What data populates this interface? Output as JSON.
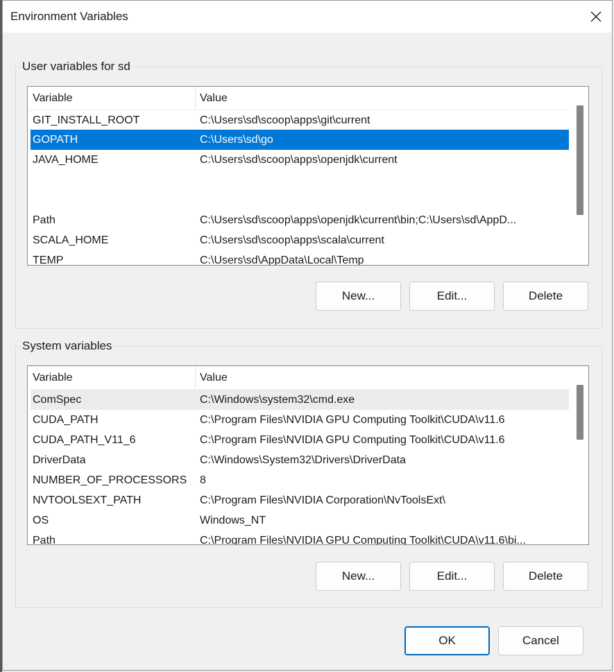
{
  "window": {
    "title": "Environment Variables",
    "close_label": "✕"
  },
  "user_section": {
    "label": "User variables for sd",
    "columns": [
      "Variable",
      "Value"
    ],
    "rows": [
      {
        "variable": "GIT_INSTALL_ROOT",
        "value": "C:\\Users\\sd\\scoop\\apps\\git\\current",
        "state": "normal"
      },
      {
        "variable": "GOPATH",
        "value": "C:\\Users\\sd\\go",
        "state": "selected"
      },
      {
        "variable": "JAVA_HOME",
        "value": "C:\\Users\\sd\\scoop\\apps\\openjdk\\current",
        "state": "normal"
      },
      {
        "variable": "Path",
        "value": "C:\\Users\\sd\\scoop\\apps\\openjdk\\current\\bin;C:\\Users\\sd\\AppD...",
        "state": "normal"
      },
      {
        "variable": "SCALA_HOME",
        "value": "C:\\Users\\sd\\scoop\\apps\\scala\\current",
        "state": "normal"
      },
      {
        "variable": "TEMP",
        "value": "C:\\Users\\sd\\AppData\\Local\\Temp",
        "state": "normal"
      }
    ],
    "buttons": {
      "new": "New...",
      "edit": "Edit...",
      "delete": "Delete"
    }
  },
  "system_section": {
    "label": "System variables",
    "columns": [
      "Variable",
      "Value"
    ],
    "rows": [
      {
        "variable": "ComSpec",
        "value": "C:\\Windows\\system32\\cmd.exe",
        "state": "hover"
      },
      {
        "variable": "CUDA_PATH",
        "value": "C:\\Program Files\\NVIDIA GPU Computing Toolkit\\CUDA\\v11.6",
        "state": "normal"
      },
      {
        "variable": "CUDA_PATH_V11_6",
        "value": "C:\\Program Files\\NVIDIA GPU Computing Toolkit\\CUDA\\v11.6",
        "state": "normal"
      },
      {
        "variable": "DriverData",
        "value": "C:\\Windows\\System32\\Drivers\\DriverData",
        "state": "normal"
      },
      {
        "variable": "NUMBER_OF_PROCESSORS",
        "value": "8",
        "state": "normal"
      },
      {
        "variable": "NVTOOLSEXT_PATH",
        "value": "C:\\Program Files\\NVIDIA Corporation\\NvToolsExt\\",
        "state": "normal"
      },
      {
        "variable": "OS",
        "value": "Windows_NT",
        "state": "normal"
      },
      {
        "variable": "Path",
        "value": "C:\\Program Files\\NVIDIA GPU Computing Toolkit\\CUDA\\v11.6\\bi...",
        "state": "normal"
      }
    ],
    "buttons": {
      "new": "New...",
      "edit": "Edit...",
      "delete": "Delete"
    }
  },
  "footer": {
    "ok": "OK",
    "cancel": "Cancel"
  },
  "colors": {
    "selection": "#0078d7",
    "default_button_border": "#0067c0"
  }
}
